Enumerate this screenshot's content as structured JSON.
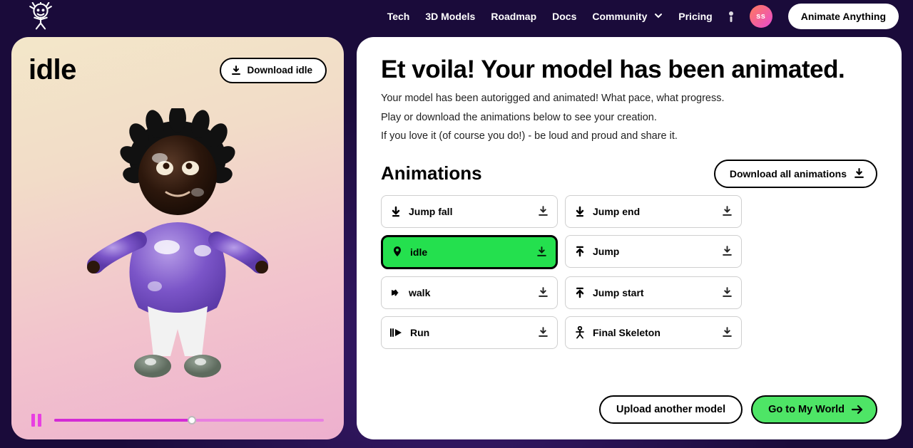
{
  "nav": {
    "links": [
      "Tech",
      "3D Models",
      "Roadmap",
      "Docs",
      "Community",
      "Pricing"
    ],
    "avatar_initials": "ss",
    "cta_label": "Animate Anything"
  },
  "preview": {
    "title": "idle",
    "download_label": "Download idle"
  },
  "panel": {
    "headline": "Et voila! Your model has been animated.",
    "body": [
      "Your model has been autorigged and animated! What pace, what progress.",
      "Play or download the animations below to see your creation.",
      "If you love it (of course you do!) - be loud and proud and share it."
    ],
    "animations_title": "Animations",
    "download_all_label": "Download all animations",
    "tiles": [
      {
        "id": "jump-fall",
        "label": "Jump fall",
        "icon": "down-arrow",
        "active": false
      },
      {
        "id": "jump-end",
        "label": "Jump end",
        "icon": "down-arrow",
        "active": false
      },
      {
        "id": "idle",
        "label": "idle",
        "icon": "pin",
        "active": true
      },
      {
        "id": "jump",
        "label": "Jump",
        "icon": "up-arrow",
        "active": false
      },
      {
        "id": "walk",
        "label": "walk",
        "icon": "right-arrow",
        "active": false
      },
      {
        "id": "jump-start",
        "label": "Jump start",
        "icon": "up-arrow",
        "active": false
      },
      {
        "id": "run",
        "label": "Run",
        "icon": "fast-right",
        "active": false
      },
      {
        "id": "skeleton",
        "label": "Final Skeleton",
        "icon": "person",
        "active": false
      }
    ],
    "upload_label": "Upload another model",
    "go_label": "Go to My World"
  },
  "colors": {
    "accent_green": "#24e04e",
    "accent_pink": "#e83fe2"
  }
}
